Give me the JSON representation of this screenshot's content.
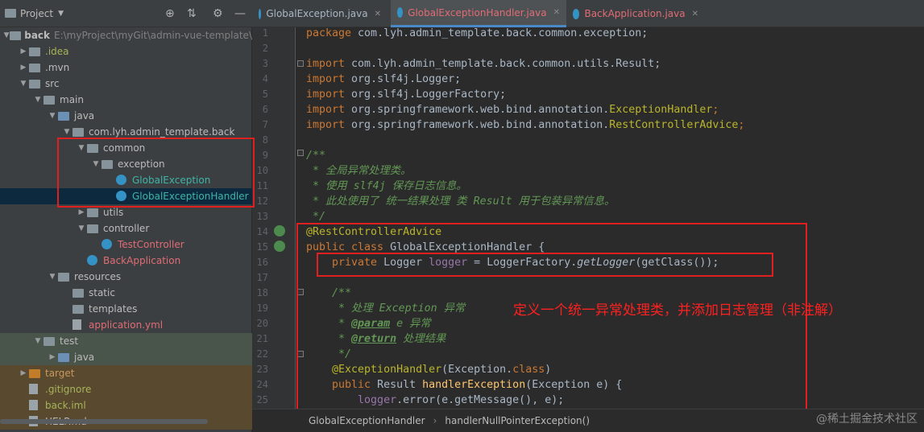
{
  "project_panel": {
    "title": "Project",
    "tree": [
      {
        "label": "back",
        "path": "E:\\myProject\\myGit\\admin-vue-template\\",
        "indent": 0,
        "arrow": "▼",
        "icon": "folder"
      },
      {
        "label": ".idea",
        "indent": 1,
        "arrow": "▶",
        "icon": "folder"
      },
      {
        "label": ".mvn",
        "indent": 1,
        "arrow": "▶",
        "icon": "folder"
      },
      {
        "label": "src",
        "indent": 1,
        "arrow": "▼",
        "icon": "folder"
      },
      {
        "label": "main",
        "indent": 2,
        "arrow": "▼",
        "icon": "folder"
      },
      {
        "label": "java",
        "indent": 3,
        "arrow": "▼",
        "icon": "folder-blue"
      },
      {
        "label": "com.lyh.admin_template.back",
        "indent": 4,
        "arrow": "▼",
        "icon": "package"
      },
      {
        "label": "common",
        "indent": 5,
        "arrow": "▼",
        "icon": "package"
      },
      {
        "label": "exception",
        "indent": 6,
        "arrow": "▼",
        "icon": "package"
      },
      {
        "label": "GlobalException",
        "indent": 7,
        "arrow": "",
        "icon": "class"
      },
      {
        "label": "GlobalExceptionHandler",
        "indent": 7,
        "arrow": "",
        "icon": "class"
      },
      {
        "label": "utils",
        "indent": 5,
        "arrow": "▶",
        "icon": "package"
      },
      {
        "label": "controller",
        "indent": 5,
        "arrow": "▼",
        "icon": "package"
      },
      {
        "label": "TestController",
        "indent": 6,
        "arrow": "",
        "icon": "class"
      },
      {
        "label": "BackApplication",
        "indent": 5,
        "arrow": "",
        "icon": "class"
      },
      {
        "label": "resources",
        "indent": 3,
        "arrow": "▼",
        "icon": "folder-res"
      },
      {
        "label": "static",
        "indent": 4,
        "arrow": "",
        "icon": "folder"
      },
      {
        "label": "templates",
        "indent": 4,
        "arrow": "",
        "icon": "folder"
      },
      {
        "label": "application.yml",
        "indent": 4,
        "arrow": "",
        "icon": "yml"
      },
      {
        "label": "test",
        "indent": 2,
        "arrow": "▼",
        "icon": "folder"
      },
      {
        "label": "java",
        "indent": 3,
        "arrow": "▶",
        "icon": "folder-blue"
      },
      {
        "label": "target",
        "indent": 1,
        "arrow": "▶",
        "icon": "folder-orange"
      },
      {
        "label": ".gitignore",
        "indent": 1,
        "arrow": "",
        "icon": "file"
      },
      {
        "label": "back.iml",
        "indent": 1,
        "arrow": "",
        "icon": "file"
      },
      {
        "label": "HELP.md",
        "indent": 1,
        "arrow": "",
        "icon": "file"
      }
    ]
  },
  "tabs": [
    {
      "label": "GlobalException.java"
    },
    {
      "label": "GlobalExceptionHandler.java"
    },
    {
      "label": "BackApplication.java"
    }
  ],
  "line_numbers": [
    "1",
    "2",
    "3",
    "4",
    "5",
    "6",
    "7",
    "8",
    "9",
    "10",
    "11",
    "12",
    "13",
    "14",
    "15",
    "16",
    "17",
    "18",
    "19",
    "20",
    "21",
    "22",
    "23",
    "24",
    "25"
  ],
  "code": {
    "l1_kw": "package ",
    "l1_rest": "com.lyh.admin_template.back.common.exception;",
    "l3_kw": "import ",
    "l3_rest": "com.lyh.admin_template.back.common.utils.Result;",
    "l4_kw": "import ",
    "l4_rest": "org.slf4j.Logger;",
    "l5_kw": "import ",
    "l5_rest": "org.slf4j.LoggerFactory;",
    "l6_kw": "import ",
    "l6_pre": "org.springframework.web.bind.annotation.",
    "l6_ann": "ExceptionHandler",
    "l6_end": ";",
    "l7_kw": "import ",
    "l7_pre": "org.springframework.web.bind.annotation.",
    "l7_ann": "RestControllerAdvice",
    "l7_end": ";",
    "l9": "/**",
    "l10": " * 全局异常处理类。",
    "l11": " * 使用 slf4j 保存日志信息。",
    "l12": " * 此处使用了 统一结果处理 类 Result 用于包装异常信息。",
    "l13": " */",
    "l14": "@RestControllerAdvice",
    "l15_kw": "public class ",
    "l15_rest": "GlobalExceptionHandler {",
    "l16_kw": "    private ",
    "l16_type": "Logger ",
    "l16_fld": "logger",
    "l16_eq": " = LoggerFactory.",
    "l16_mth": "getLogger",
    "l16_end": "(getClass());",
    "l18": "    /**",
    "l19": "     * 处理 Exception 异常",
    "l20_pre": "     * ",
    "l20_tag": "@param",
    "l20_rest": " e 异常",
    "l21_pre": "     * ",
    "l21_tag": "@return",
    "l21_rest": " 处理结果",
    "l22": "     */",
    "l23_ann": "    @ExceptionHandler",
    "l23_rest": "(Exception.",
    "l23_kw": "class",
    "l23_end": ")",
    "l24_kw": "    public ",
    "l24_type": "Result ",
    "l24_mth": "handlerException",
    "l24_rest": "(Exception e) {",
    "l25_fld": "        logger",
    "l25_rest": ".error(e.getMessage(), e);"
  },
  "annotation_note": "定义一个统一异常处理类，并添加日志管理（非注解）",
  "status_bar": {
    "crumb1": "GlobalExceptionHandler",
    "sep": "›",
    "crumb2": "handlerNullPointerException()"
  },
  "watermark": "@稀土掘金技术社区"
}
